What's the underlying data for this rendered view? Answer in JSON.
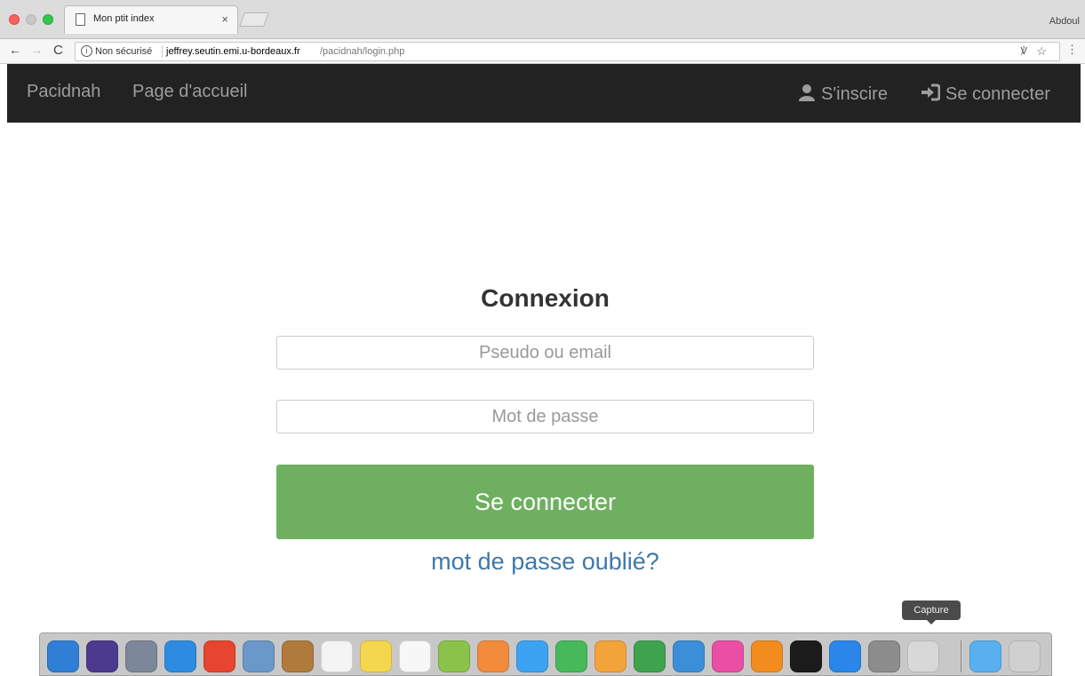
{
  "browser": {
    "tab_title": "Mon ptit index",
    "tab_close": "×",
    "profile_name": "Abdoul",
    "security_label": "Non sécurisé",
    "url_host": "jeffrey.seutin.emi.u-bordeaux.fr",
    "url_path": "/pacidnah/login.php",
    "info_icon": "i"
  },
  "navbar": {
    "brand": "Pacidnah",
    "home": "Page d'accueil",
    "signup": "S'inscire",
    "login": "Se connecter"
  },
  "form": {
    "title": "Connexion",
    "username_placeholder": "Pseudo ou email",
    "password_placeholder": "Mot de passe",
    "submit_label": "Se connecter",
    "forgot_link": "mot de passe oublié?"
  },
  "dock": {
    "tooltip": "Capture",
    "apps": [
      {
        "name": "finder-icon",
        "color": "#2f7fd6"
      },
      {
        "name": "siri-icon",
        "color": "#4b3a8e"
      },
      {
        "name": "launchpad-icon",
        "color": "#7c8899"
      },
      {
        "name": "safari-icon",
        "color": "#2e8ce0"
      },
      {
        "name": "chrome-icon",
        "color": "#e6452f"
      },
      {
        "name": "preview-icon",
        "color": "#6a98c8"
      },
      {
        "name": "contacts-icon",
        "color": "#b07a3c"
      },
      {
        "name": "calendar-icon",
        "color": "#f4f4f4"
      },
      {
        "name": "notes-icon",
        "color": "#f5d64f"
      },
      {
        "name": "reminders-icon",
        "color": "#f7f7f7"
      },
      {
        "name": "maps-icon",
        "color": "#8bc34a"
      },
      {
        "name": "photos-icon",
        "color": "#f28b3c"
      },
      {
        "name": "messages-icon",
        "color": "#3ca3f3"
      },
      {
        "name": "facetime-icon",
        "color": "#46b95a"
      },
      {
        "name": "pages-icon",
        "color": "#f2a33a"
      },
      {
        "name": "numbers-icon",
        "color": "#3fa34d"
      },
      {
        "name": "keynote-icon",
        "color": "#3b8fd8"
      },
      {
        "name": "itunes-icon",
        "color": "#e94fa4"
      },
      {
        "name": "ibooks-icon",
        "color": "#f28c1e"
      },
      {
        "name": "terminal-icon",
        "color": "#1b1b1b"
      },
      {
        "name": "app-store-icon",
        "color": "#2a86e8"
      },
      {
        "name": "system-preferences-icon",
        "color": "#8c8c8c"
      },
      {
        "name": "screenshot-icon",
        "color": "#d8d8d8"
      },
      {
        "name": "downloads-folder-icon",
        "color": "#5ab0ef"
      },
      {
        "name": "trash-icon",
        "color": "#d0d0d0"
      }
    ]
  }
}
